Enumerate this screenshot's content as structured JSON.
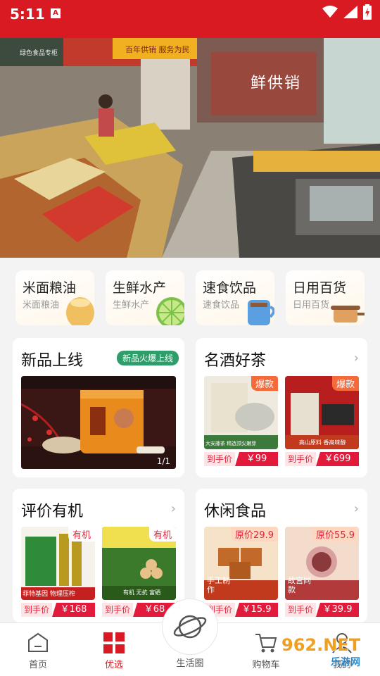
{
  "status": {
    "time": "5:11",
    "notif_letter": "A"
  },
  "banner": {
    "sign_left": "绿色食品专柜",
    "sign_mid": "百年供销 服务为民",
    "sign_right": "鲜供销"
  },
  "categories": [
    {
      "title": "米面粮油",
      "subtitle": "米面粮油"
    },
    {
      "title": "生鲜水产",
      "subtitle": "生鲜水产"
    },
    {
      "title": "速食饮品",
      "subtitle": "速食饮品"
    },
    {
      "title": "日用百货",
      "subtitle": "日用百货"
    }
  ],
  "new_products": {
    "title": "新品上线",
    "badge": "新品火爆上线",
    "pager": "1/1"
  },
  "wine_tea": {
    "title": "名酒好茶",
    "items": [
      {
        "tag": "爆款",
        "caption": "大安藤茶 精选顶尖嫩芽",
        "price_label": "到手价",
        "price": "￥99"
      },
      {
        "tag": "爆款",
        "caption": "高山原料 香高味醇",
        "price_label": "到手价",
        "price": "￥699"
      }
    ]
  },
  "reviews": {
    "title": "评价有机",
    "items": [
      {
        "tag": "有机",
        "caption": "菲特基因 物理压榨",
        "price_label": "到手价",
        "price": "￥168"
      },
      {
        "tag": "有机",
        "caption": "有机 无抗 富硒",
        "price_label": "到手价",
        "price": "￥68"
      }
    ]
  },
  "snacks": {
    "title": "休闲食品",
    "items": [
      {
        "tag": "原价29.9",
        "caption": "手工制作",
        "price_label": "到手价",
        "price": "￥15.9"
      },
      {
        "tag": "原价55.9",
        "caption": "故宫同款",
        "price_label": "到手价",
        "price": "￥39.9"
      }
    ]
  },
  "nav": {
    "items": [
      {
        "label": "首页"
      },
      {
        "label": "优选"
      },
      {
        "label": "生活圈"
      },
      {
        "label": "购物车"
      },
      {
        "label": "我的"
      }
    ]
  },
  "watermark": {
    "top": "962.NET",
    "bottom": "乐游网"
  },
  "colors": {
    "brand_red": "#d91a22",
    "badge_green": "#2e9d6a",
    "price_red": "#e21b3c"
  }
}
